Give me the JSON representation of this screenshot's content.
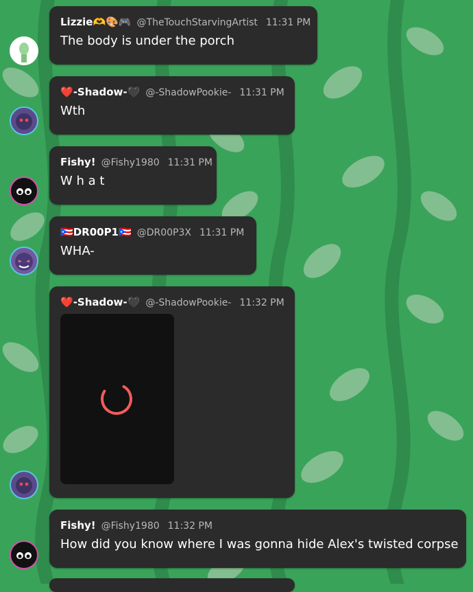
{
  "messages": [
    {
      "name": "Lizzie🫶🎨🎮",
      "handle": "@TheTouchStarvingArtist",
      "time": "11:31 PM",
      "text": "The body is under the porch"
    },
    {
      "name_prefix": "❤️",
      "name": "-Shadow-",
      "name_suffix": "🖤",
      "handle": "@-ShadowPookie-",
      "time": "11:31 PM",
      "text": "Wth"
    },
    {
      "name": "Fishy!",
      "handle": "@Fishy1980",
      "time": "11:31 PM",
      "text": "W h a t"
    },
    {
      "name_prefix": "🇵🇷",
      "name": "DR00P1",
      "name_suffix": "🇵🇷",
      "handle": "@DR00P3X",
      "time": "11:31 PM",
      "text": "WHA-"
    },
    {
      "name_prefix": "❤️",
      "name": "-Shadow-",
      "name_suffix": "🖤",
      "handle": "@-ShadowPookie-",
      "time": "11:32 PM",
      "media": "loading"
    },
    {
      "name": "Fishy!",
      "handle": "@Fishy1980",
      "time": "11:32 PM",
      "text": "How did you know where I was gonna hide Alex's twisted corpse"
    }
  ],
  "colors": {
    "background": "#3aa35a",
    "bubble": "#2b2b2b",
    "meta_text": "#b9b9b9",
    "spinner": "#f25c5c"
  }
}
